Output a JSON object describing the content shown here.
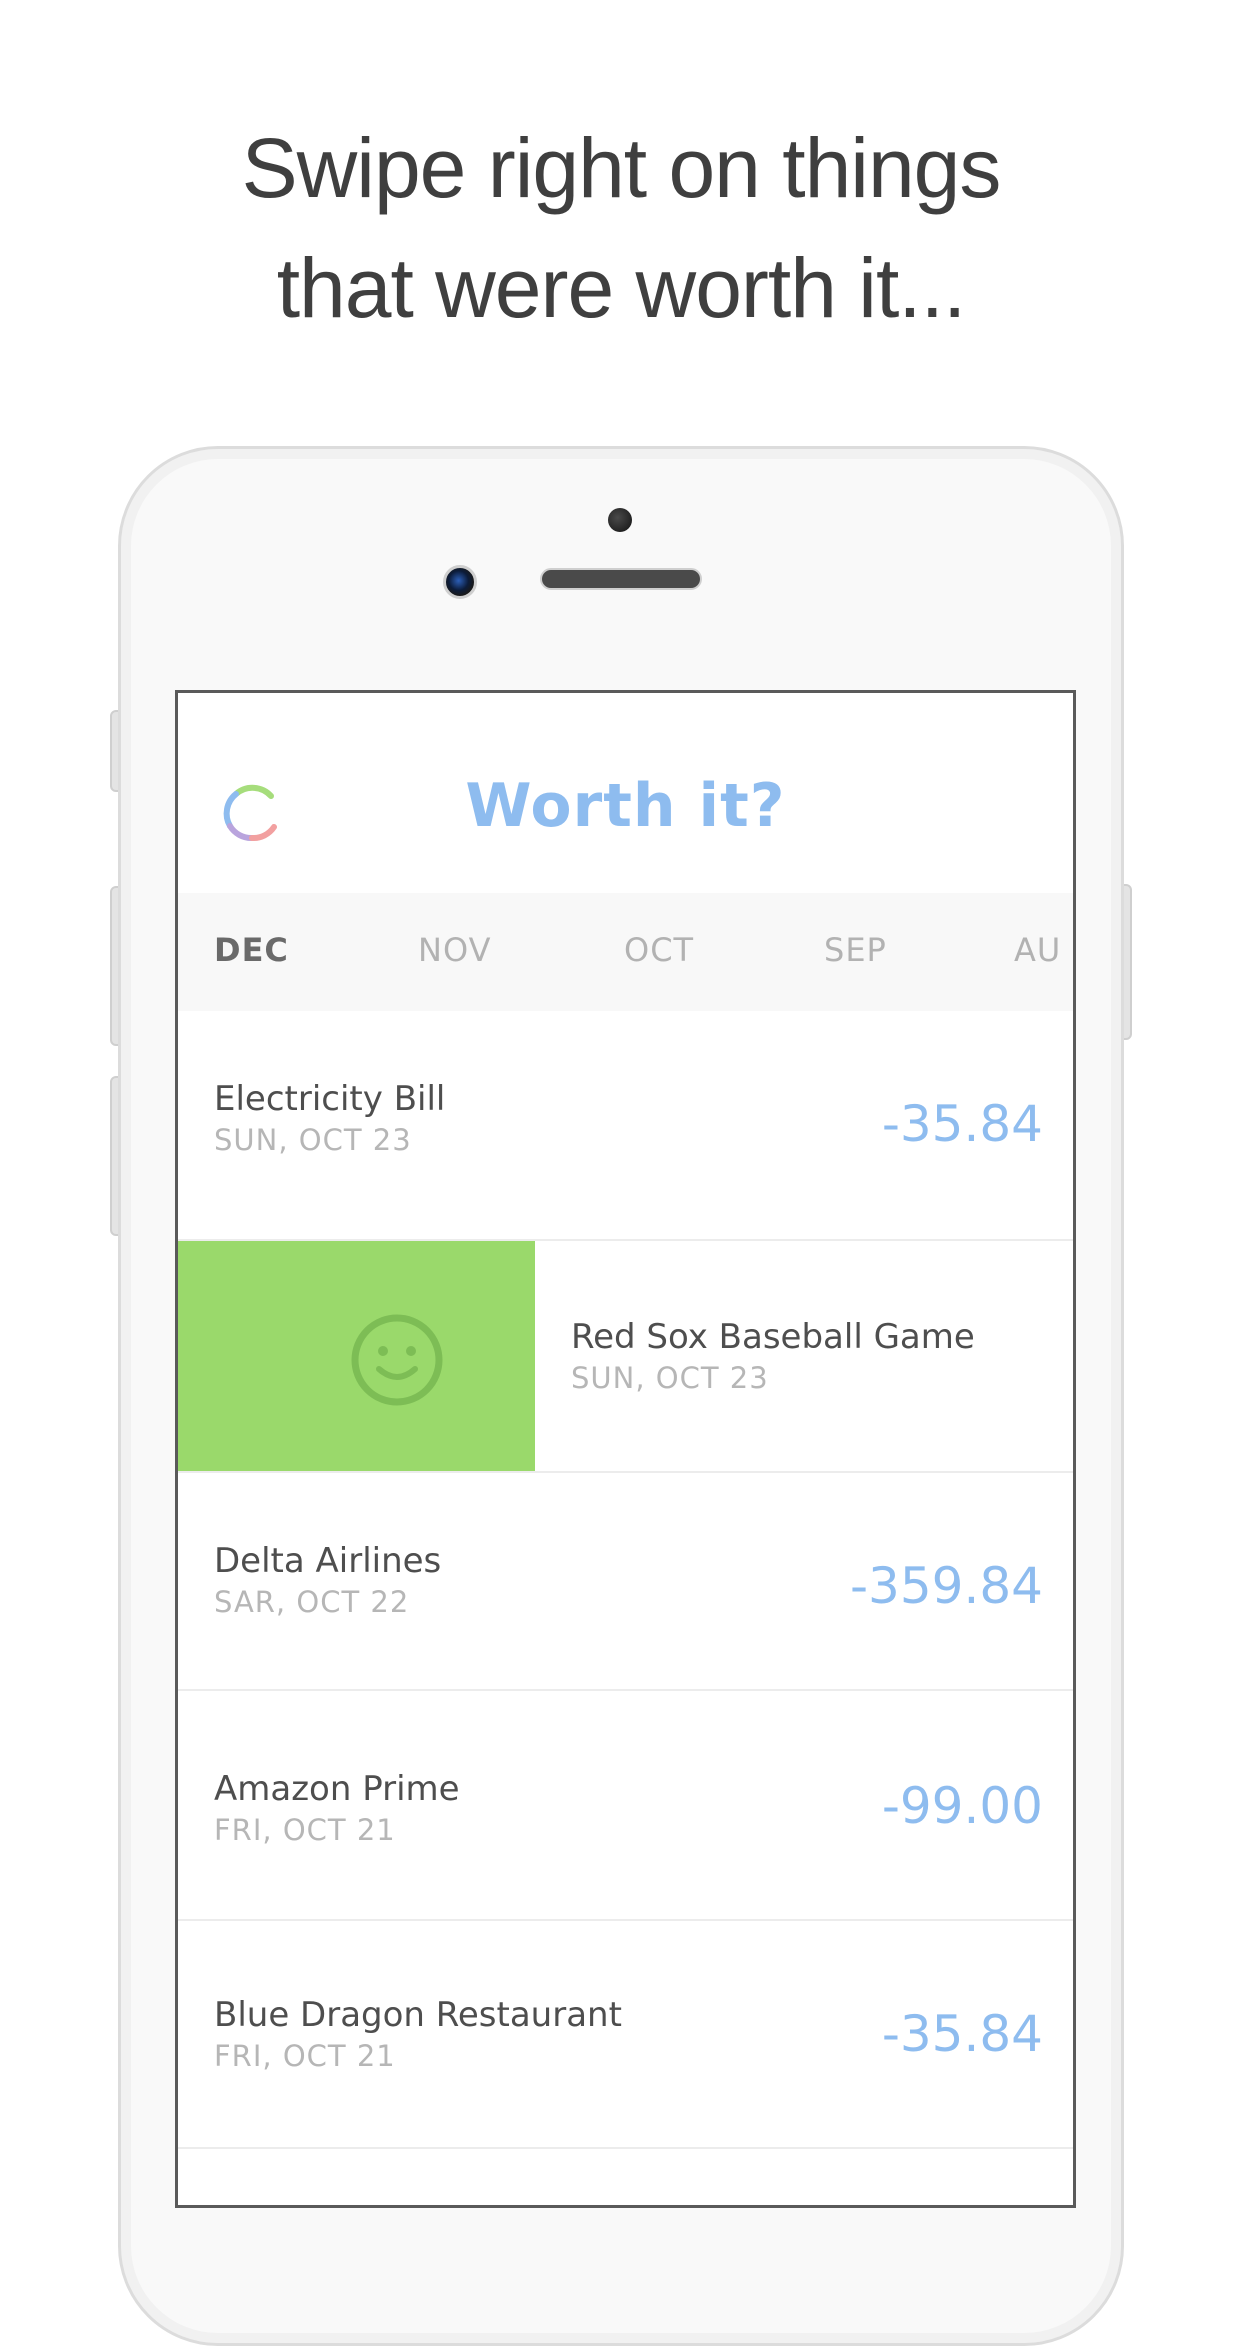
{
  "headline": {
    "line1": "Swipe right on things",
    "line2": "that were worth it..."
  },
  "app": {
    "title": "Worth it?",
    "logo_icon": "ring-logo-icon"
  },
  "months": [
    "DEC",
    "NOV",
    "OCT",
    "SEP",
    "AU"
  ],
  "active_month": "DEC",
  "transactions": [
    {
      "name": "Electricity Bill",
      "date": "SUN, OCT 23",
      "amount": "-35.84"
    },
    {
      "name": "Red Sox Baseball Game",
      "date": "SUN, OCT 23",
      "amount": "",
      "swiped": true,
      "swipe_icon": "smiley-face-icon"
    },
    {
      "name": "Delta Airlines",
      "date": "SAR, OCT 22",
      "amount": "-359.84"
    },
    {
      "name": "Amazon Prime",
      "date": "FRI, OCT 21",
      "amount": "-99.00"
    },
    {
      "name": "Blue Dragon Restaurant",
      "date": "FRI, OCT 21",
      "amount": "-35.84"
    }
  ],
  "colors": {
    "accent_blue": "#8ebcef",
    "swipe_green": "#9ad96b",
    "text_dark": "#4e4e4e",
    "text_muted": "#b6b6b6"
  }
}
